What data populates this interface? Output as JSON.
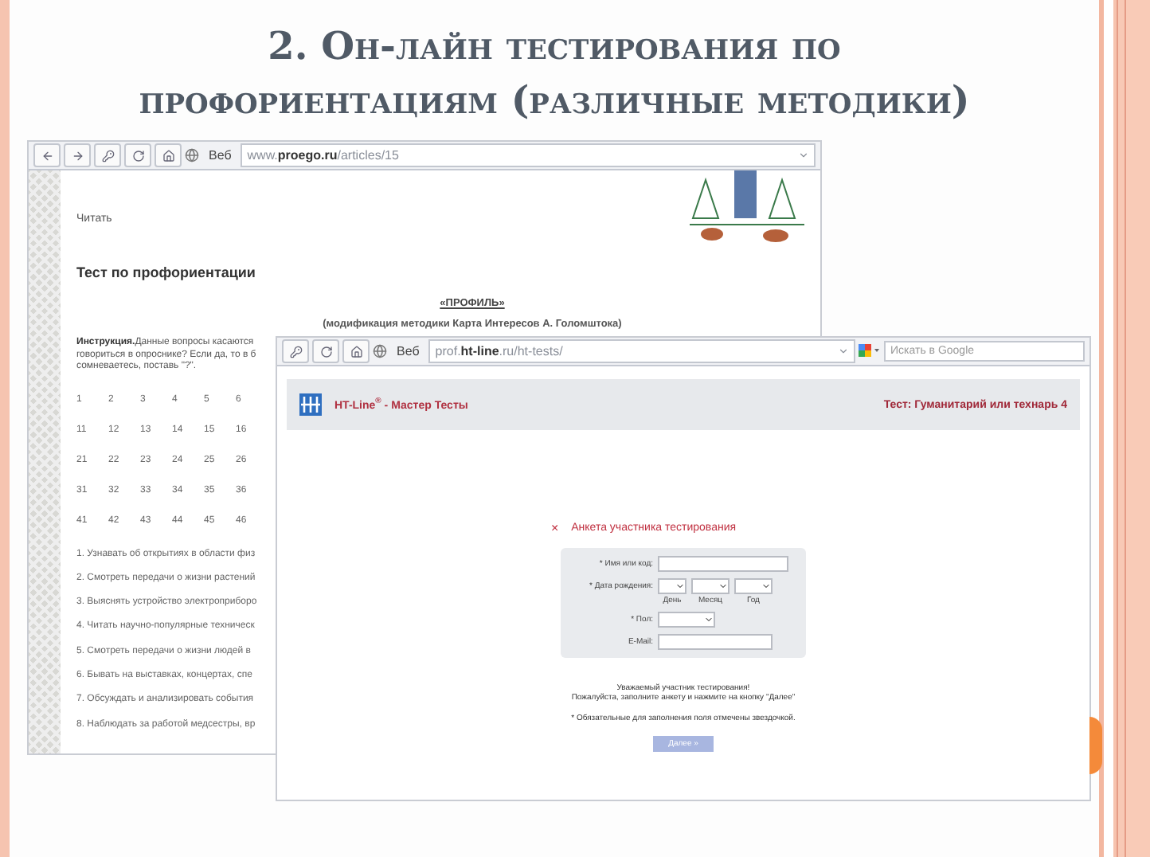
{
  "slide": {
    "title": "2. Он-лайн тестирования по профориентациям (различные методики)"
  },
  "window_back": {
    "toolbar": {
      "web_label": "Веб",
      "url": "www.**proego.ru**/articles/15"
    },
    "read_link": "Читать",
    "heading": "Тест по профориентации",
    "test_name": "«ПРОФИЛЬ»",
    "subtitle": "(модификация методики Карта Интересов А. Голомштока)",
    "instruction": [
      "**Инструкция.**Данные вопросы касаются",
      "говориться в опроснике? Если да, то в б",
      "сомневаетесь, поставь \"?\"."
    ],
    "number_grid": [
      [
        "1",
        "2",
        "3",
        "4",
        "5",
        "6"
      ],
      [
        "11",
        "12",
        "13",
        "14",
        "15",
        "16"
      ],
      [
        "21",
        "22",
        "23",
        "24",
        "25",
        "26"
      ],
      [
        "31",
        "32",
        "33",
        "34",
        "35",
        "36"
      ],
      [
        "41",
        "42",
        "43",
        "44",
        "45",
        "46"
      ]
    ],
    "questions": [
      "1. Узнавать об открытиях в области физ",
      "2. Смотреть передачи о жизни растений",
      "3. Выяснять устройство электроприборо",
      "4. Читать научно-популярные техническ",
      "5. Смотреть передачи о жизни людей в",
      "6. Бывать на выставках, концертах, спе",
      "7. Обсуждать и анализировать события",
      "8. Наблюдать за работой медсестры, вр"
    ]
  },
  "window_front": {
    "toolbar": {
      "web_label": "Веб",
      "url": "prof.**ht-line**.ru/ht-tests/",
      "search": {
        "placeholder": "Искать в Google"
      }
    },
    "site": {
      "logo_text": "HT-Line$^{®}$ - Мастер Тесты",
      "test_title": "Тест: Гуманитарий или технарь 4"
    },
    "form": {
      "close_mark": "×",
      "title": "Анкета участника тестирования",
      "fields": [
        {
          "kind": "text",
          "label": "* Имя или код:"
        },
        {
          "kind": "date",
          "label": "* Дата рождения:",
          "parts": [
            "День",
            "Месяц",
            "Год"
          ]
        },
        {
          "kind": "select",
          "label": "* Пол:"
        },
        {
          "kind": "text",
          "label": "E-Mail:"
        }
      ]
    },
    "messages": [
      "Уважаемый участник тестирования!",
      "Пожалуйста, заполните анкету и нажмите на кнопку \"Далее\"",
      "* Обязательные для заполнения поля отмечены звездочкой."
    ],
    "button": "Далее »"
  }
}
